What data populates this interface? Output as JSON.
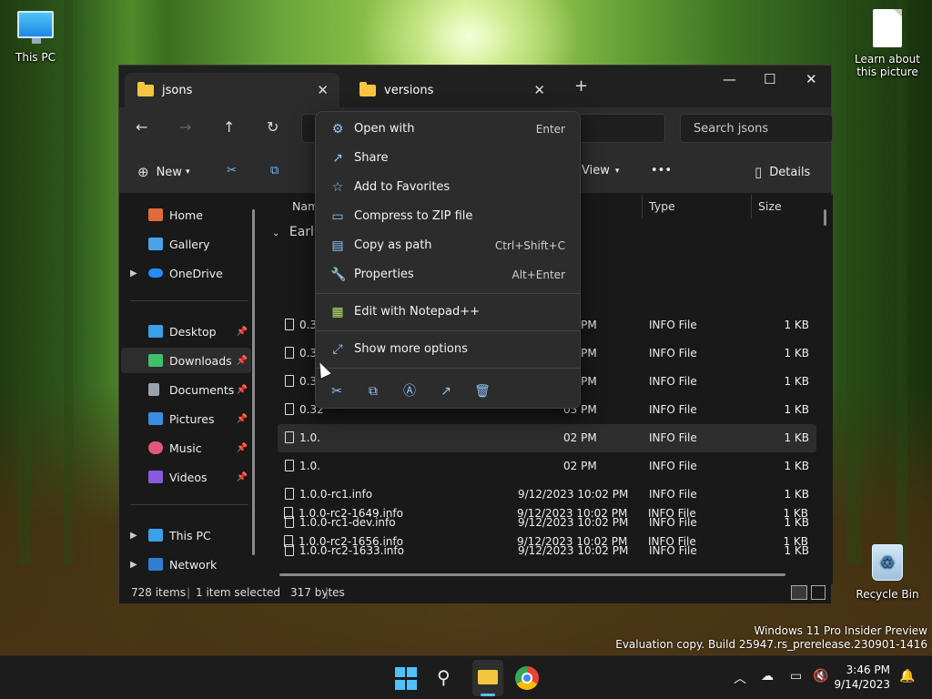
{
  "desktop": {
    "this_pc": "This PC",
    "learn_about": "Learn about this picture",
    "recycle_bin": "Recycle Bin",
    "watermark_line1": "Windows 11 Pro Insider Preview",
    "watermark_line2": "Evaluation copy. Build 25947.rs_prerelease.230901-1416"
  },
  "explorer": {
    "tabs": [
      {
        "label": "jsons"
      },
      {
        "label": "versions"
      }
    ],
    "search_placeholder": "Search jsons",
    "commands": {
      "new": "New",
      "view": "View",
      "more": "•••",
      "details": "Details"
    },
    "sidebar": {
      "home": "Home",
      "gallery": "Gallery",
      "onedrive": "OneDrive",
      "desktop": "Desktop",
      "downloads": "Downloads",
      "documents": "Documents",
      "pictures": "Pictures",
      "music": "Music",
      "videos": "Videos",
      "this_pc": "This PC",
      "network": "Network"
    },
    "columns": {
      "name": "Name",
      "date": "d",
      "type": "Type",
      "size": "Size"
    },
    "group_label": "Earlie",
    "rows": [
      {
        "name": "0.32",
        "date": "03 PM",
        "type": "INFO File",
        "size": "1 KB"
      },
      {
        "name": "0.32",
        "date": "03 PM",
        "type": "INFO File",
        "size": "1 KB"
      },
      {
        "name": "0.32",
        "date": "03 PM",
        "type": "INFO File",
        "size": "1 KB"
      },
      {
        "name": "0.32",
        "date": "03 PM",
        "type": "INFO File",
        "size": "1 KB"
      },
      {
        "name": "1.0.",
        "date": "02 PM",
        "type": "INFO File",
        "size": "1 KB"
      },
      {
        "name": "1.0.",
        "date": "02 PM",
        "type": "INFO File",
        "size": "1 KB"
      },
      {
        "name": "1.0.0-rc1.info",
        "date": "9/12/2023 10:02 PM",
        "type": "INFO File",
        "size": "1 KB"
      },
      {
        "name": "1.0.0-rc1-dev.info",
        "date": "9/12/2023 10:02 PM",
        "type": "INFO File",
        "size": "1 KB"
      },
      {
        "name": "1.0.0-rc2-1633.info",
        "date": "9/12/2023 10:02 PM",
        "type": "INFO File",
        "size": "1 KB"
      },
      {
        "name": "1.0.0-rc2-1649.info",
        "date": "9/12/2023 10:02 PM",
        "type": "INFO File",
        "size": "1 KB"
      },
      {
        "name": "1.0.0-rc2-1656.info",
        "date": "9/12/2023 10:02 PM",
        "type": "INFO File",
        "size": "1 KB"
      }
    ],
    "status": {
      "items": "728 items",
      "selected": "1 item selected",
      "size": "317 bytes"
    }
  },
  "context_menu": {
    "items": [
      {
        "label": "Open with",
        "shortcut": "Enter"
      },
      {
        "label": "Share",
        "shortcut": ""
      },
      {
        "label": "Add to Favorites",
        "shortcut": ""
      },
      {
        "label": "Compress to ZIP file",
        "shortcut": ""
      },
      {
        "label": "Copy as path",
        "shortcut": "Ctrl+Shift+C"
      },
      {
        "label": "Properties",
        "shortcut": "Alt+Enter"
      }
    ],
    "notepad": "Edit with Notepad++",
    "more_options": "Show more options"
  },
  "taskbar": {
    "time": "3:46 PM",
    "date": "9/14/2023"
  }
}
